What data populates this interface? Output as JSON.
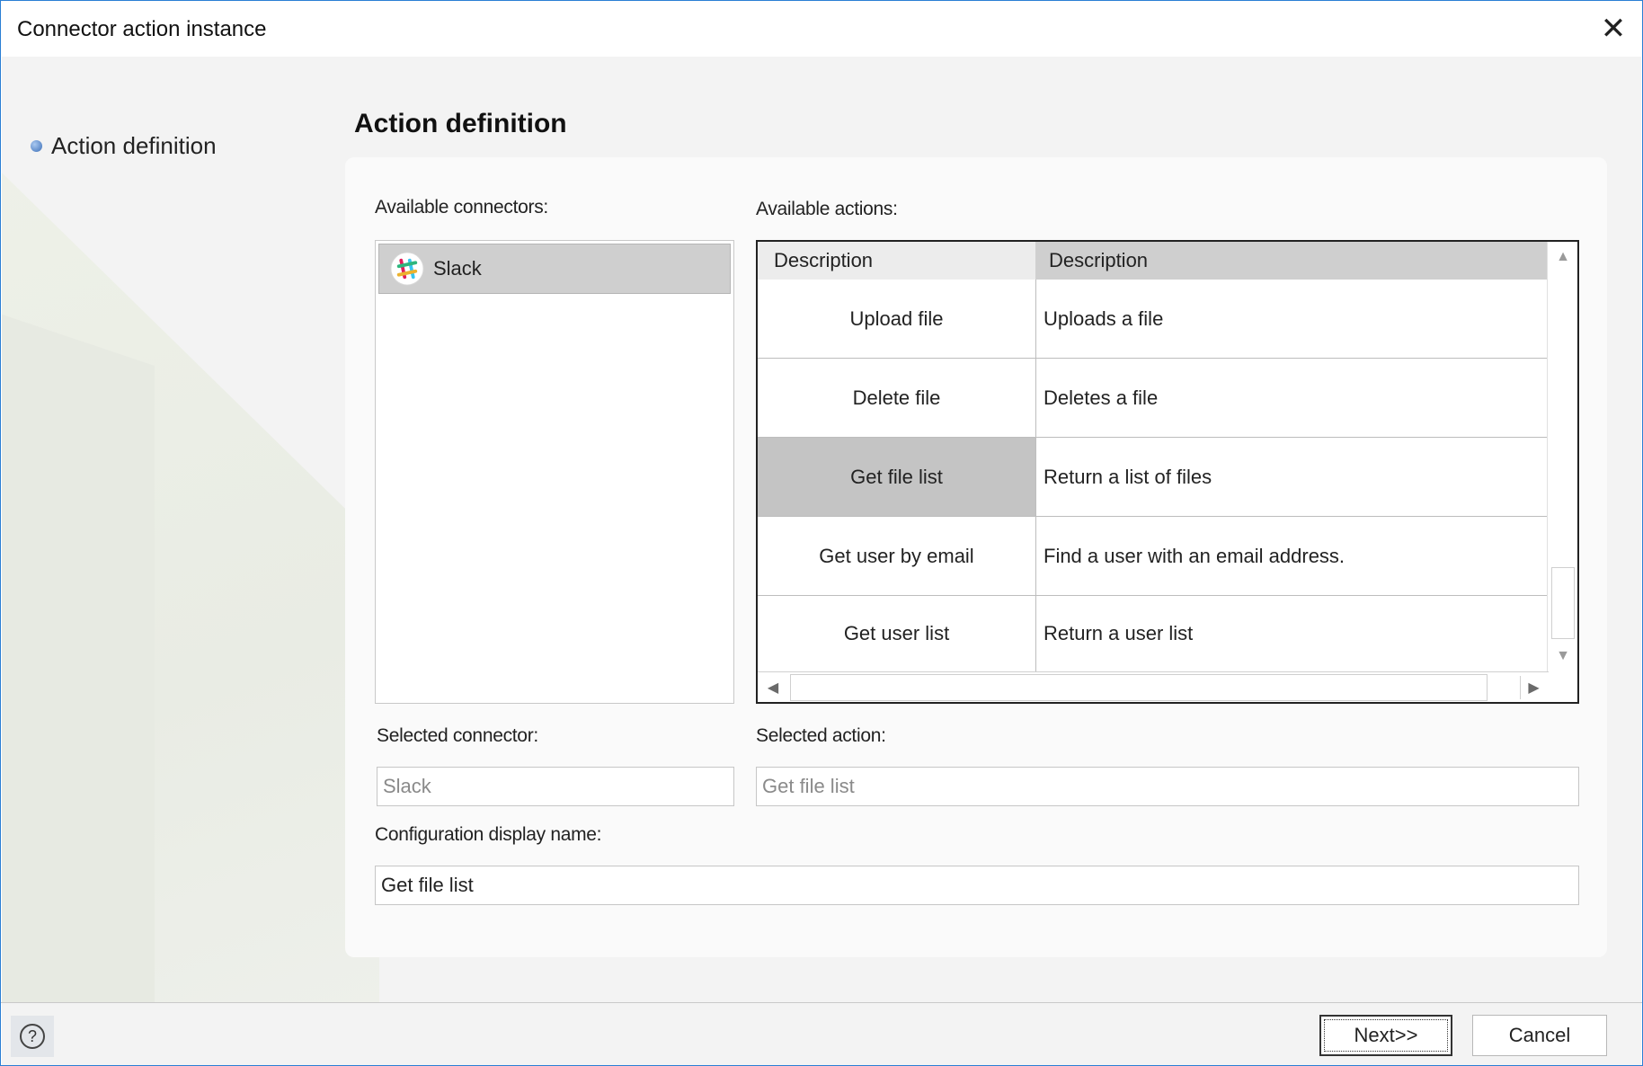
{
  "window": {
    "title": "Connector action instance"
  },
  "nav": {
    "steps": [
      {
        "label": "Action definition",
        "active": true
      }
    ]
  },
  "page": {
    "title": "Action definition"
  },
  "connectors": {
    "label": "Available connectors:",
    "items": [
      {
        "name": "Slack",
        "icon": "slack-icon",
        "selected": true
      }
    ]
  },
  "actions": {
    "label": "Available actions:",
    "columns": [
      "Description",
      "Description"
    ],
    "rows": [
      {
        "name": "Upload file",
        "description": "Uploads a file"
      },
      {
        "name": "Delete file",
        "description": "Deletes a file"
      },
      {
        "name": "Get file list",
        "description": "Return a list of files",
        "selected": true
      },
      {
        "name": "Get user by email",
        "description": "Find a user with an email address."
      },
      {
        "name": "Get user list",
        "description": "Return a user list"
      }
    ]
  },
  "selected_connector": {
    "label": "Selected connector:",
    "value": "Slack"
  },
  "selected_action": {
    "label": "Selected action:",
    "value": "Get file list"
  },
  "config_name": {
    "label": "Configuration display name:",
    "value": "Get file list"
  },
  "footer": {
    "next_label": "Next>>",
    "cancel_label": "Cancel"
  },
  "colors": {
    "accent_border": "#2b7fd4",
    "selected_row": "#c4c4c4",
    "panel_bg": "#fafafa"
  }
}
